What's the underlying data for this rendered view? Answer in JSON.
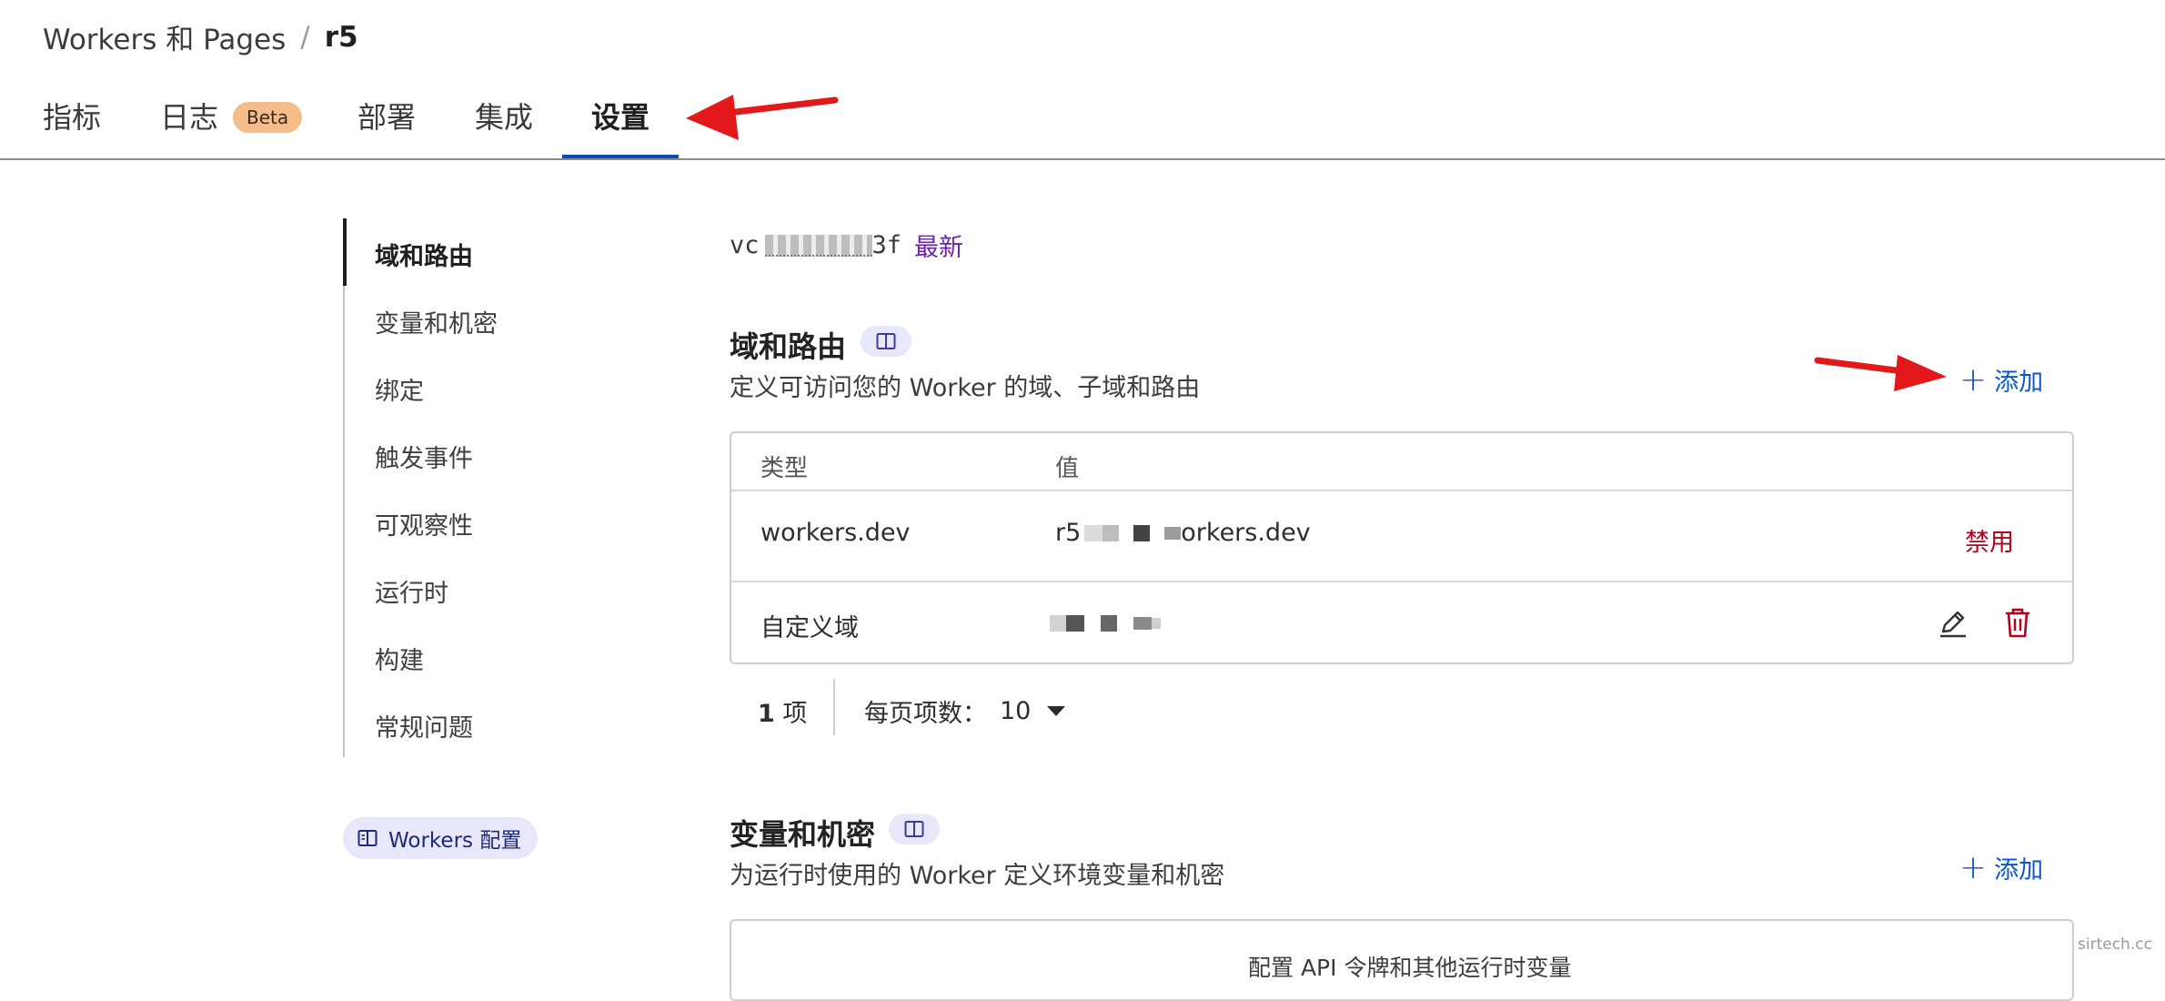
{
  "breadcrumb": {
    "parent": "Workers 和 Pages",
    "separator": "/",
    "current": "r5"
  },
  "tabs": [
    {
      "label": "指标"
    },
    {
      "label": "日志",
      "badge": "Beta"
    },
    {
      "label": "部署"
    },
    {
      "label": "集成"
    },
    {
      "label": "设置",
      "active": true
    }
  ],
  "sidebar": {
    "items": [
      {
        "label": "域和路由",
        "active": true
      },
      {
        "label": "变量和机密"
      },
      {
        "label": "绑定"
      },
      {
        "label": "触发事件"
      },
      {
        "label": "可观察性"
      },
      {
        "label": "运行时"
      },
      {
        "label": "构建"
      },
      {
        "label": "常规问题"
      }
    ],
    "docs_pill": "Workers 配置"
  },
  "version": {
    "prefix": "v",
    "partial": "c",
    "suffix": "3f",
    "latest_label": "最新"
  },
  "domains": {
    "title": "域和路由",
    "description": "定义可访问您的 Worker 的域、子域和路由",
    "add_label": "添加",
    "table": {
      "headers": [
        "类型",
        "值"
      ],
      "rows": [
        {
          "type": "workers.dev",
          "value_start": "r5",
          "value_end": "orkers.dev",
          "action": "禁用"
        },
        {
          "type": "自定义域",
          "value_start": "",
          "value_end": ""
        }
      ]
    },
    "pagination": {
      "count": "1",
      "count_unit": "项",
      "per_page_label": "每页项数：",
      "per_page_value": "10"
    }
  },
  "variables": {
    "title": "变量和机密",
    "description": "为运行时使用的 Worker 定义环境变量和机密",
    "add_label": "添加",
    "box_text": "配置 API 令牌和其他运行时变量"
  },
  "watermark": "sirtech.cc",
  "colors": {
    "accent_blue": "#0a4bb5",
    "link_blue": "#0a57d0",
    "danger_red": "#b3001b",
    "latest_purple": "#6b21a8",
    "beta_orange": "#f6bd8c",
    "annotation_arrow": "#e3181b"
  }
}
